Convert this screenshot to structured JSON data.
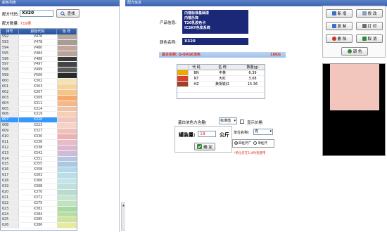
{
  "left": {
    "title": "颜色列表",
    "search_label": "配方代码:",
    "search_value": "X320",
    "search_button": "查找",
    "count_label": "配方数量:",
    "count_value": "719条",
    "columns": [
      "排号",
      "颜色代码",
      "色 样"
    ],
    "rows": [
      {
        "num": "592",
        "code": "V476",
        "color": "#b7a89c"
      },
      {
        "num": "593",
        "code": "V478",
        "color": "#a89d96"
      },
      {
        "num": "594",
        "code": "V480",
        "color": "#c0a79a"
      },
      {
        "num": "595",
        "code": "V484",
        "color": "#b9a39a"
      },
      {
        "num": "596",
        "code": "V488",
        "color": "#3a3a3a"
      },
      {
        "num": "597",
        "code": "V497",
        "color": "#444444"
      },
      {
        "num": "598",
        "code": "V499",
        "color": "#5a5a5a"
      },
      {
        "num": "599",
        "code": "V500",
        "color": "#2a2a2a"
      },
      {
        "num": "600",
        "code": "X302",
        "color": "#f4e2b3"
      },
      {
        "num": "601",
        "code": "X303",
        "color": "#f6d39a"
      },
      {
        "num": "602",
        "code": "X307",
        "color": "#f8c684"
      },
      {
        "num": "603",
        "code": "X309",
        "color": "#f6a968"
      },
      {
        "num": "604",
        "code": "X311",
        "color": "#f7b889"
      },
      {
        "num": "605",
        "code": "X314",
        "color": "#f4c2a2"
      },
      {
        "num": "606",
        "code": "X319",
        "color": "#f6cfb5"
      },
      {
        "num": "607",
        "code": "X320",
        "color": "#f2c6bd"
      },
      {
        "num": "608",
        "code": "X323",
        "color": "#f4d4c8"
      },
      {
        "num": "609",
        "code": "X327",
        "color": "#f2c0b8"
      },
      {
        "num": "610",
        "code": "X330",
        "color": "#eeb1b3"
      },
      {
        "num": "611",
        "code": "X336",
        "color": "#e8bcc7"
      },
      {
        "num": "612",
        "code": "X338",
        "color": "#dcb7cf"
      },
      {
        "num": "613",
        "code": "X342",
        "color": "#cdbbd8"
      },
      {
        "num": "614",
        "code": "X351",
        "color": "#b9c4e3"
      },
      {
        "num": "615",
        "code": "X355",
        "color": "#a9c8e4"
      },
      {
        "num": "616",
        "code": "X358",
        "color": "#b2d8e9"
      },
      {
        "num": "617",
        "code": "X363",
        "color": "#b7dfe8"
      },
      {
        "num": "618",
        "code": "X366",
        "color": "#c4e4ea"
      },
      {
        "num": "619",
        "code": "X368",
        "color": "#bfe0dc"
      },
      {
        "num": "620",
        "code": "X370",
        "color": "#b7dbcf"
      },
      {
        "num": "621",
        "code": "X372",
        "color": "#c8e3d0"
      },
      {
        "num": "622",
        "code": "X375",
        "color": "#bfe3bf"
      },
      {
        "num": "623",
        "code": "X382",
        "color": "#a9d8a2"
      },
      {
        "num": "624",
        "code": "X384",
        "color": "#b8dda2"
      },
      {
        "num": "625",
        "code": "X385",
        "color": "#cfe39d"
      },
      {
        "num": "626",
        "code": "X386",
        "color": "#e6ea9d"
      }
    ],
    "selected_index": 15
  },
  "right": {
    "title": "配方信息",
    "product_label": "产品信息:",
    "product_lines": [
      "内墙标准基础漆",
      "内墙乐饰",
      "T20乳胶色卡",
      "ICSKY色浆系统"
    ],
    "color_name_label": "颜色名称:",
    "color_name": "X320",
    "base_label": "基本名称:  Q-BASE浅色",
    "base_amount": "18KG",
    "ingr_columns": [
      "代 码",
      "名 称",
      "数量(g)"
    ],
    "ingredients": [
      {
        "code": "BN",
        "name": "中黄",
        "qty": "6.39",
        "color": "#f0a800"
      },
      {
        "code": "NT",
        "name": "大红",
        "qty": "3.08",
        "color": "#d84030"
      },
      {
        "code": "HZ",
        "name": "黄相铁红",
        "qty": "15.36",
        "color": "#a04028"
      }
    ],
    "strength_label": "基白浓色力含量(",
    "strength_value": "标准值",
    "show_price_label": "显示价格",
    "fill_label": "罐装量:",
    "fill_value": "18",
    "fill_unit": "公斤",
    "confirm_button": "确 定",
    "unit_label": "单位名称(",
    "unit_value": "克",
    "radio_1": "四桂尺广",
    "radio_2": "单桂尺",
    "note": "*单位仅在1/4时到使用",
    "buttons": {
      "new": "新 增",
      "edit": "修 改",
      "copy": "复 制",
      "print": "打 印",
      "delete": "删 除",
      "cancel": "取 消",
      "dispense": "调 色"
    },
    "preview_color": "#f2c6bd"
  }
}
